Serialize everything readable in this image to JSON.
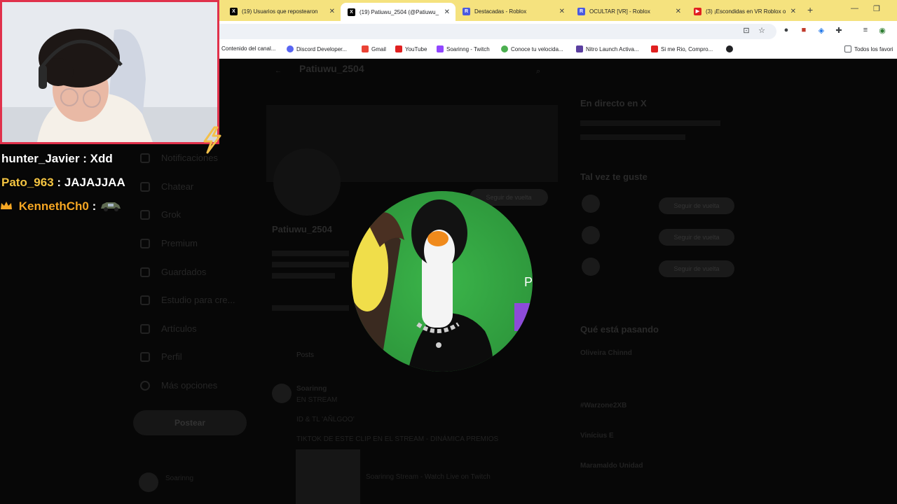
{
  "browser": {
    "tabs": [
      {
        "title": "(19) Usuarios que repostearon",
        "favicon": "x-icon",
        "active": false
      },
      {
        "title": "(19) Patiuwu_2504 (@Patiuwu_",
        "favicon": "x-icon",
        "active": true
      },
      {
        "title": "Destacadas - Roblox",
        "favicon": "roblox-icon",
        "active": false
      },
      {
        "title": "OCULTAR [VR] - Roblox",
        "favicon": "roblox-icon",
        "active": false
      },
      {
        "title": "(3) ¡Escondidas en VR Roblox o",
        "favicon": "youtube-icon",
        "active": false
      }
    ],
    "new_tab": "+",
    "bookmarks": [
      {
        "label": "Contenido del canal...",
        "color": "#e02020"
      },
      {
        "label": "Discord Developer...",
        "color": "#5865f2"
      },
      {
        "label": "Gmail",
        "color": "#ea4335"
      },
      {
        "label": "YouTube",
        "color": "#e02020"
      },
      {
        "label": "Soarinng - Twitch",
        "color": "#9146ff"
      },
      {
        "label": "Conoce tu velocida...",
        "color": "#4caf50"
      },
      {
        "label": "Nitro Launch Activa...",
        "color": "#5b3fa0"
      },
      {
        "label": "Si me Rio, Compro...",
        "color": "#e02020"
      }
    ],
    "bookmarks_folder": "Todos los favori"
  },
  "page": {
    "profile_name": "Patiuwu_2504",
    "nav": [
      "Notificaciones",
      "Chatear",
      "Grok",
      "Premium",
      "Guardados",
      "Estudio para cre...",
      "Artículos",
      "Perfil",
      "Más opciones"
    ],
    "post_button": "Postear",
    "follow_button": "Seguir de vuelta",
    "tab_posts": "Posts",
    "live_heading": "En directo en X",
    "suggest_heading": "Tal vez te guste",
    "trending_heading": "Qué está pasando",
    "trends": [
      "Oliveira Chinnd",
      "#Warzone2XB",
      "Vinícius E",
      "Maramaldo Unidad"
    ],
    "tweet_author": "Soarinng",
    "tweet_line1": "EN STREAM",
    "tweet_line2": "ID & TL 'AÑLGOO'",
    "tweet_line3": "TIKTOK DE ESTE CLIP EN EL STREAM - DINÁMICA PREMIOS",
    "tweet_card": "Soarinng Stream - Watch Live on Twitch",
    "bottom_user": "Soarinng"
  },
  "stream_overlay": {
    "chat": [
      {
        "user": "hunter_Javier",
        "message": "Xdd",
        "user_color": "#ffffff",
        "badge": null
      },
      {
        "user": "Pato_963",
        "message": "JAJAJJAA",
        "user_color": "#f5c542",
        "badge": null
      },
      {
        "user": "KennethCh0",
        "message": "",
        "user_color": "#f5a623",
        "badge": "crown-icon"
      }
    ],
    "separator": ":",
    "webcam_border": "#e0314b"
  }
}
